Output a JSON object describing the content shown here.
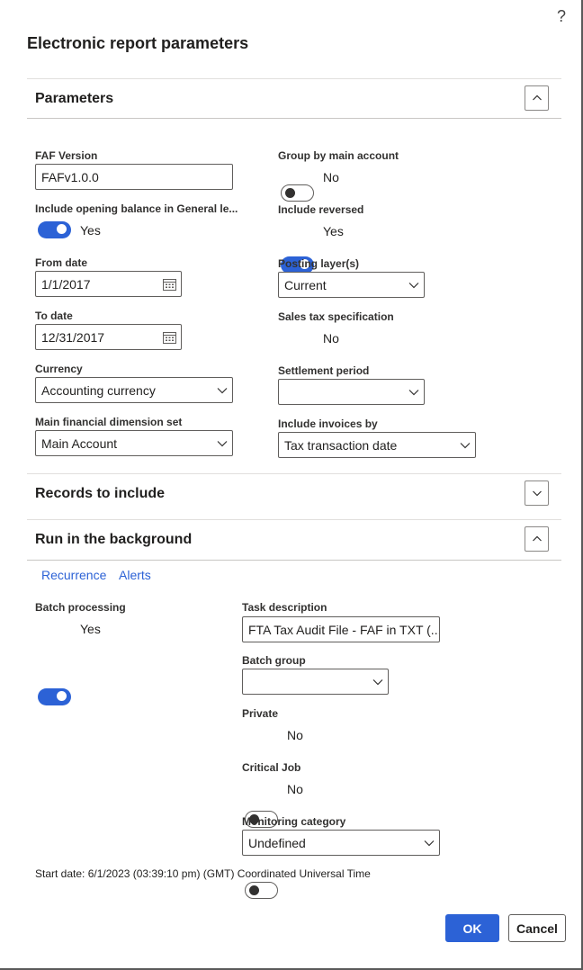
{
  "dialog": {
    "title": "Electronic report parameters",
    "help_label": "?"
  },
  "parameters": {
    "heading": "Parameters",
    "faf_version": {
      "label": "FAF Version",
      "value": "FAFv1.0.0"
    },
    "opening_balance": {
      "label": "Include opening balance in General le...",
      "state": "Yes",
      "on": true
    },
    "from_date": {
      "label": "From date",
      "value": "1/1/2017"
    },
    "to_date": {
      "label": "To date",
      "value": "12/31/2017"
    },
    "currency": {
      "label": "Currency",
      "value": "Accounting currency"
    },
    "dimension_set": {
      "label": "Main financial dimension set",
      "value": "Main Account"
    },
    "group_by_main": {
      "label": "Group by main account",
      "state": "No",
      "on": false
    },
    "include_reversed": {
      "label": "Include reversed",
      "state": "Yes",
      "on": true
    },
    "posting_layers": {
      "label": "Posting layer(s)",
      "value": "Current"
    },
    "sales_tax_spec": {
      "label": "Sales tax specification",
      "state": "No",
      "on": false
    },
    "settlement_period": {
      "label": "Settlement period",
      "value": ""
    },
    "include_invoices_by": {
      "label": "Include invoices by",
      "value": "Tax transaction date"
    }
  },
  "records": {
    "heading": "Records to include"
  },
  "background": {
    "heading": "Run in the background",
    "links": [
      "Recurrence",
      "Alerts"
    ],
    "batch_processing": {
      "label": "Batch processing",
      "state": "Yes",
      "on": true
    },
    "task_description": {
      "label": "Task description",
      "value": "FTA Tax Audit File - FAF in TXT (..."
    },
    "batch_group": {
      "label": "Batch group",
      "value": ""
    },
    "private": {
      "label": "Private",
      "state": "No",
      "on": false
    },
    "critical_job": {
      "label": "Critical Job",
      "state": "No",
      "on": false
    },
    "monitoring_category": {
      "label": "Monitoring category",
      "value": "Undefined"
    },
    "start_date": "Start date: 6/1/2023 (03:39:10 pm) (GMT) Coordinated Universal Time"
  },
  "footer": {
    "ok_label": "OK",
    "cancel_label": "Cancel"
  },
  "colors": {
    "accent": "#2c62d6",
    "text": "#201f1e",
    "border": "#605e5c"
  }
}
